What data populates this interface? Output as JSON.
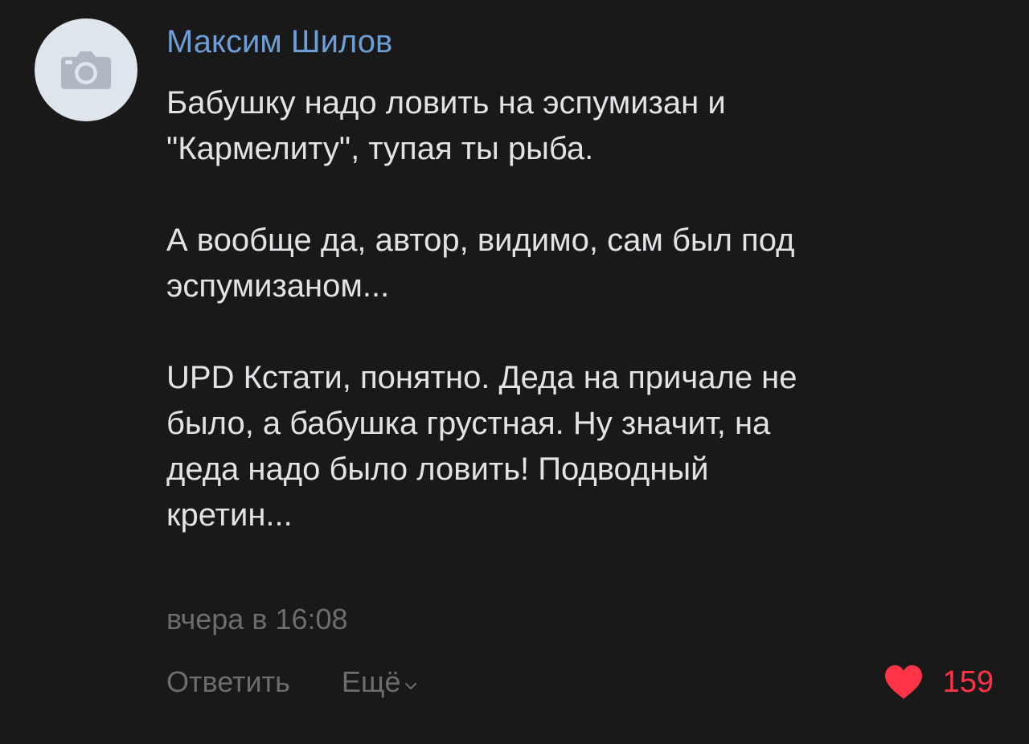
{
  "comment": {
    "author": "Максим Шилов",
    "paragraphs": [
      "Бабушку надо ловить на эспумизан и\n\"Кармелиту\", тупая ты рыба.",
      "А вообще да, автор, видимо, сам был под\nэспумизаном...",
      "UPD Кстати, понятно. Деда на причале не\nбыло, а бабушка грустная. Ну значит, на\nдеда надо было ловить! Подводный\nкретин..."
    ],
    "timestamp": "вчера в 16:08",
    "actions": {
      "reply": "Ответить",
      "more": "Ещё"
    },
    "likes": {
      "count": "159",
      "liked": true
    }
  },
  "icons": {
    "avatar_placeholder": "camera-icon",
    "more": "chevron-down-icon",
    "like": "heart-icon"
  },
  "colors": {
    "background": "#19191a",
    "author": "#6e9ed6",
    "text": "#e1e3e6",
    "secondary": "#6b6d70",
    "like": "#ff3347",
    "avatar_bg": "#dfe5ec"
  }
}
